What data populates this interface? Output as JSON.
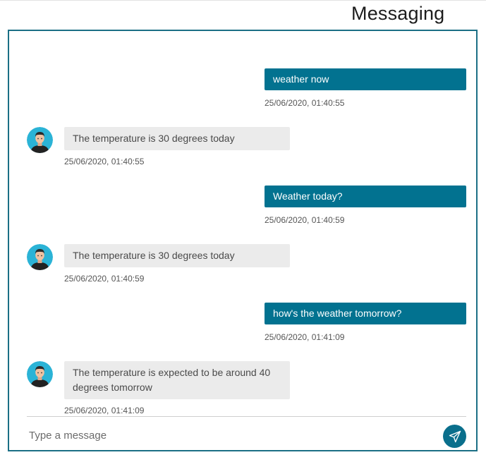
{
  "header": {
    "title": "Messaging"
  },
  "messages": [
    {
      "direction": "out",
      "text": "weather now",
      "time": "25/06/2020, 01:40:55"
    },
    {
      "direction": "in",
      "text": "The temperature is 30 degrees today",
      "time": "25/06/2020, 01:40:55"
    },
    {
      "direction": "out",
      "text": "Weather today?",
      "time": "25/06/2020, 01:40:59"
    },
    {
      "direction": "in",
      "text": "The temperature is 30 degrees today",
      "time": "25/06/2020, 01:40:59"
    },
    {
      "direction": "out",
      "text": "how's the weather tomorrow?",
      "time": "25/06/2020, 01:41:09"
    },
    {
      "direction": "in",
      "text": "The temperature is expected to be around 40 degrees tomorrow",
      "time": "25/06/2020, 01:41:09"
    }
  ],
  "composer": {
    "placeholder": "Type a message",
    "value": "",
    "send_icon": "paper-plane-icon"
  },
  "colors": {
    "accent": "#027290",
    "panel_border": "#1b6f85",
    "incoming_bubble": "#ebebeb",
    "avatar_bg": "#2bb3d6"
  }
}
